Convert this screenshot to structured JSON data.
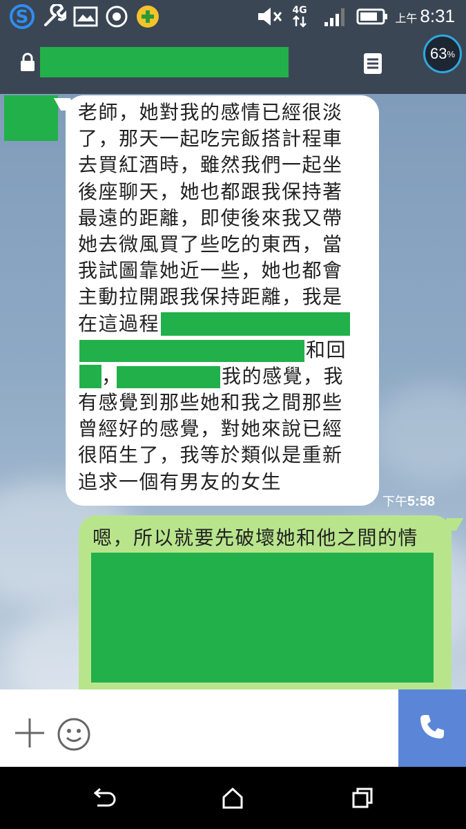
{
  "status_bar": {
    "time_prefix": "上午",
    "time": "8:31",
    "network": "4G",
    "icons": [
      "s-logo-icon",
      "wrench-icon",
      "image-icon",
      "record-icon",
      "plus-app-icon",
      "mute-icon",
      "signal-icon",
      "battery-icon"
    ]
  },
  "header": {
    "lock_icon": "lock-icon",
    "menu_icon": "menu-icon",
    "battery_percent": "63",
    "percent_sign": "%"
  },
  "chat": {
    "incoming": {
      "lines": [
        "老師，她對我的感情已經很淡",
        "了，那天一起吃完飯搭計程車",
        "去買紅酒時，雖然我們一起坐",
        "後座聊天，她也都跟我保持著",
        "最遠的距離，即使後來我又帶",
        "她去微風買了些吃的東西，當",
        "我試圖靠她近一些，她也都會",
        "主動拉開跟我保持距離，我是",
        "在這過程",
        "和回",
        "，",
        "我的感覺，我",
        "有感覺到那些她和我之間那些",
        "曾經好的感覺，對她來說已經",
        "很陌生了，我等於類似是重新",
        "追求一個有男友的女生"
      ],
      "time_prefix": "下午",
      "time": "5:58"
    },
    "outgoing": {
      "first_line": "嗯，所以就要先破壞她和他之間的情"
    }
  },
  "input_bar": {
    "plus_icon": "plus-icon",
    "emoji_icon": "smiley-icon",
    "call_icon": "phone-icon"
  },
  "nav_bar": {
    "icons": [
      "back-icon",
      "home-icon",
      "recents-icon"
    ]
  },
  "colors": {
    "header_bg": "#3b4654",
    "redaction": "#22b04a",
    "outgoing_bubble": "#b8e58c",
    "call_button": "#5b86d8"
  }
}
